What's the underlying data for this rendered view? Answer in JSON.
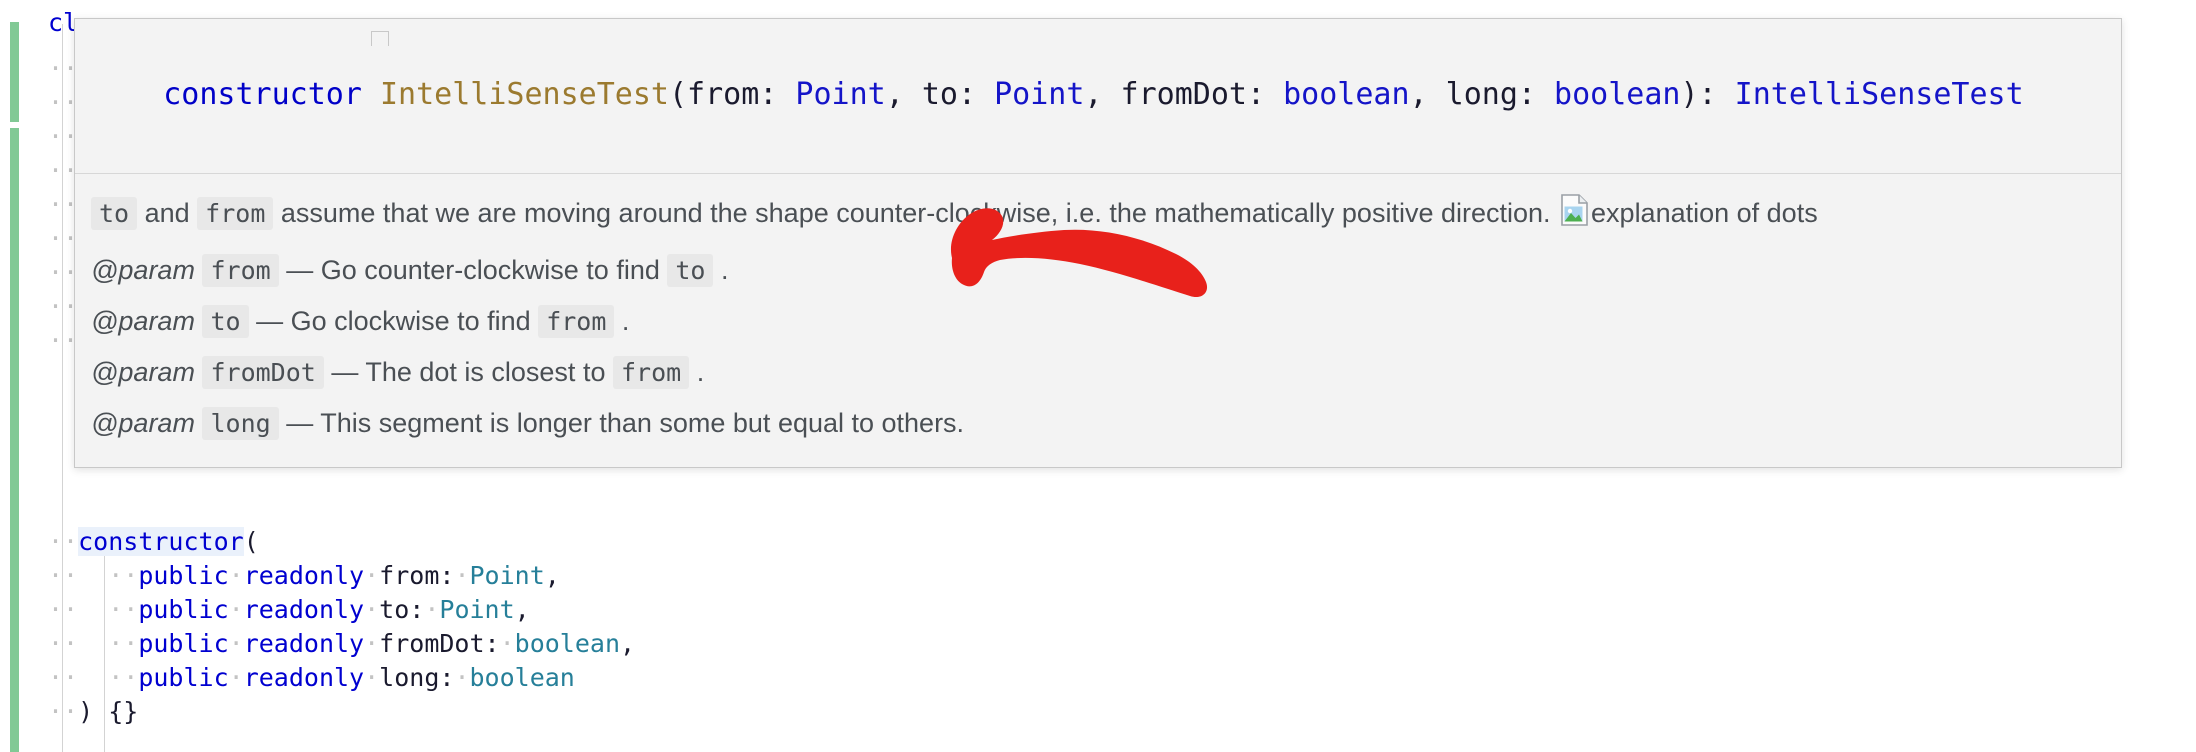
{
  "editor": {
    "visible_prefix_line": "cl",
    "code_lines": [
      {
        "indent_dots": "··",
        "tokens": [
          {
            "text": "constructor",
            "kind": "keyword-highlight"
          },
          {
            "text": "(",
            "kind": "punctuation"
          }
        ]
      },
      {
        "indent_dots": "··  ··",
        "tokens": [
          {
            "text": "public",
            "kind": "keyword"
          },
          {
            "text": "·",
            "kind": "dot"
          },
          {
            "text": "readonly",
            "kind": "keyword"
          },
          {
            "text": "·",
            "kind": "dot"
          },
          {
            "text": "from:",
            "kind": "plain"
          },
          {
            "text": "·",
            "kind": "dot"
          },
          {
            "text": "Point",
            "kind": "type"
          },
          {
            "text": ",",
            "kind": "punctuation"
          }
        ]
      },
      {
        "indent_dots": "··  ··",
        "tokens": [
          {
            "text": "public",
            "kind": "keyword"
          },
          {
            "text": "·",
            "kind": "dot"
          },
          {
            "text": "readonly",
            "kind": "keyword"
          },
          {
            "text": "·",
            "kind": "dot"
          },
          {
            "text": "to:",
            "kind": "plain"
          },
          {
            "text": "·",
            "kind": "dot"
          },
          {
            "text": "Point",
            "kind": "type"
          },
          {
            "text": ",",
            "kind": "punctuation"
          }
        ]
      },
      {
        "indent_dots": "··  ··",
        "tokens": [
          {
            "text": "public",
            "kind": "keyword"
          },
          {
            "text": "·",
            "kind": "dot"
          },
          {
            "text": "readonly",
            "kind": "keyword"
          },
          {
            "text": "·",
            "kind": "dot"
          },
          {
            "text": "fromDot:",
            "kind": "plain"
          },
          {
            "text": "·",
            "kind": "dot"
          },
          {
            "text": "boolean",
            "kind": "type"
          },
          {
            "text": ",",
            "kind": "punctuation"
          }
        ]
      },
      {
        "indent_dots": "··  ··",
        "tokens": [
          {
            "text": "public",
            "kind": "keyword"
          },
          {
            "text": "·",
            "kind": "dot"
          },
          {
            "text": "readonly",
            "kind": "keyword"
          },
          {
            "text": "·",
            "kind": "dot"
          },
          {
            "text": "long:",
            "kind": "plain"
          },
          {
            "text": "·",
            "kind": "dot"
          },
          {
            "text": "boolean",
            "kind": "type"
          }
        ]
      },
      {
        "indent_dots": "··",
        "tokens": [
          {
            "text": ") {}",
            "kind": "punctuation"
          }
        ]
      }
    ]
  },
  "hover": {
    "signature": {
      "keyword": "constructor",
      "name": "IntelliSenseTest",
      "open_paren": "(",
      "params": [
        {
          "label": "from: ",
          "type": "Point",
          "separator": ", "
        },
        {
          "label": "to: ",
          "type": "Point",
          "separator": ", "
        },
        {
          "label": "fromDot: ",
          "type": "boolean",
          "separator": ", "
        },
        {
          "label": "long: ",
          "type": "boolean",
          "separator": ""
        }
      ],
      "close_paren": ")",
      "return_separator": ": ",
      "return_type": "IntelliSenseTest"
    },
    "description": {
      "code_to": "to",
      "joiner": " and ",
      "code_from": "from",
      "text_part1": " assume that we are moving around the shape counter-clockwise, i.e. the mathematically positive direction. ",
      "image_alt": "explanation of dots",
      "image_state": "broken-image"
    },
    "params": [
      {
        "tag": "@param",
        "name": "from",
        "dash": "—",
        "description_pre": "Go counter-clockwise to find ",
        "description_code": "to",
        "description_post": "."
      },
      {
        "tag": "@param",
        "name": "to",
        "dash": "—",
        "description_pre": "Go clockwise to find ",
        "description_code": "from",
        "description_post": "."
      },
      {
        "tag": "@param",
        "name": "fromDot",
        "dash": "—",
        "description_pre": "The dot is closest to ",
        "description_code": "from",
        "description_post": "."
      },
      {
        "tag": "@param",
        "name": "long",
        "dash": "—",
        "description_pre": "This segment is longer than some but equal to others.",
        "description_code": "",
        "description_post": ""
      }
    ]
  },
  "annotation": {
    "shape": "hand-drawn-arrow",
    "color": "#e8211b",
    "points_to": "broken-image-placeholder"
  },
  "colors": {
    "hover_background": "#f3f3f3",
    "hover_border": "#c8c8c8",
    "inline_code_background": "#e8e8e8",
    "gutter_modified": "#81c995",
    "keyword_blue": "#0000d0",
    "type_teal": "#267f99",
    "signature_name": "#9b7a2f",
    "doc_text": "#4a4f54",
    "annotation_red": "#e8211b"
  }
}
